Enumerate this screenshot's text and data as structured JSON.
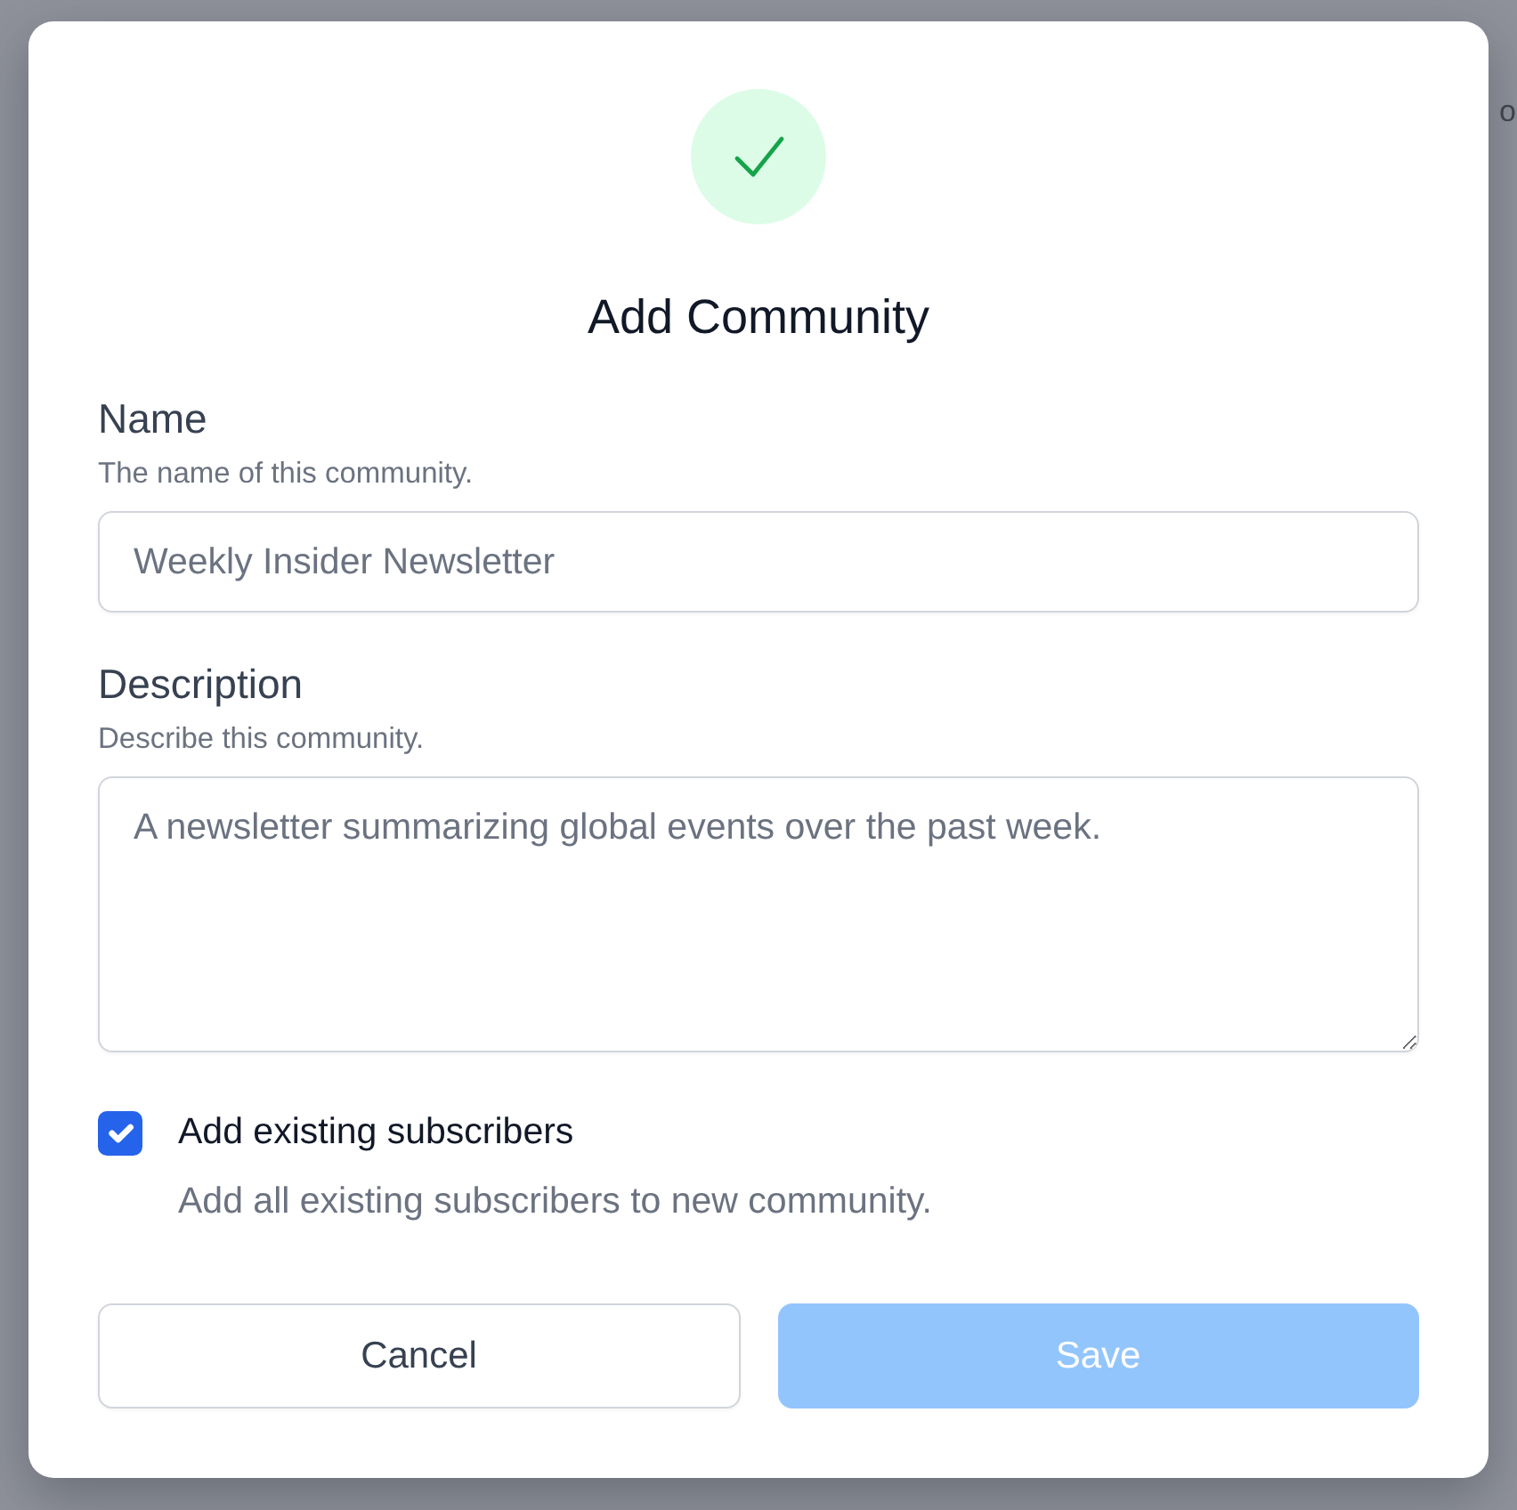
{
  "backdrop": {
    "text": "o"
  },
  "dialog": {
    "title": "Add Community"
  },
  "fields": [
    {
      "kind": "input",
      "label": "Name",
      "hint": "The name of this community.",
      "value": "Weekly Insider Newsletter"
    },
    {
      "kind": "textarea",
      "label": "Description",
      "hint": "Describe this community.",
      "value": "A newsletter summarizing global events over the past week."
    }
  ],
  "option": {
    "label": "Add existing subscribers",
    "hint": "Add all existing subscribers to new community.",
    "checked": true
  },
  "buttons": [
    {
      "kind": "secondary",
      "label": "Cancel",
      "disabled": false
    },
    {
      "kind": "primary",
      "label": "Save",
      "disabled": true
    }
  ]
}
